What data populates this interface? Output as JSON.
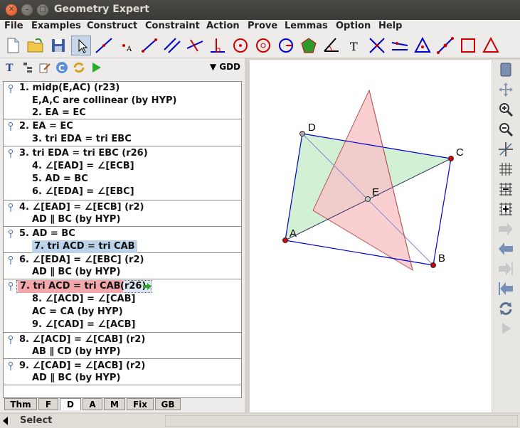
{
  "window": {
    "title": "Geometry Expert"
  },
  "menu": [
    "File",
    "Examples",
    "Construct",
    "Constraint",
    "Action",
    "Prove",
    "Lemmas",
    "Option",
    "Help"
  ],
  "proof_panel": {
    "mode_label": "GDD",
    "steps": [
      {
        "lines": [
          "1. midp(E,AC)  (r23)",
          "E,A,C are collinear   (by HYP)",
          "2. EA = EC"
        ]
      },
      {
        "lines": [
          "2. EA = EC",
          "3. tri EDA = tri EBC"
        ]
      },
      {
        "lines": [
          "3. tri EDA = tri EBC  (r26)",
          "4. ∠[EAD] = ∠[ECB]",
          "5. AD = BC",
          "6. ∠[EDA] = ∠[EBC]"
        ]
      },
      {
        "lines": [
          "4. ∠[EAD] = ∠[ECB]  (r2)",
          "AD ∥ BC   (by HYP)"
        ]
      },
      {
        "lines": [
          "5. AD = BC",
          "7. tri ACD = tri CAB"
        ]
      },
      {
        "lines": [
          "6. ∠[EDA] = ∠[EBC]  (r2)",
          "AD ∥ BC   (by HYP)"
        ]
      },
      {
        "lines": [
          "7. tri ACD = tri CAB",
          "(r26)",
          "8. ∠[ACD] = ∠[CAB]",
          "AC = CA   (by HYP)",
          "9. ∠[CAD] = ∠[ACB]"
        ]
      },
      {
        "lines": [
          "8. ∠[ACD] = ∠[CAB]  (r2)",
          "AB ∥ CD   (by HYP)"
        ]
      },
      {
        "lines": [
          "9. ∠[CAD] = ∠[ACB]  (r2)",
          "AD ∥ BC   (by HYP)"
        ]
      }
    ],
    "tabs": [
      "Thm",
      "F",
      "D",
      "A",
      "M",
      "Fix",
      "GB"
    ],
    "active_tab": "D"
  },
  "canvas": {
    "points": [
      "D",
      "C",
      "E",
      "A",
      "B"
    ],
    "colors": {
      "green_fill": "#cdeecf",
      "pink_fill": "#f8c3c7",
      "edge_blue": "#0000cc",
      "point_red": "#cc0000"
    }
  },
  "status": {
    "text": "Select"
  }
}
